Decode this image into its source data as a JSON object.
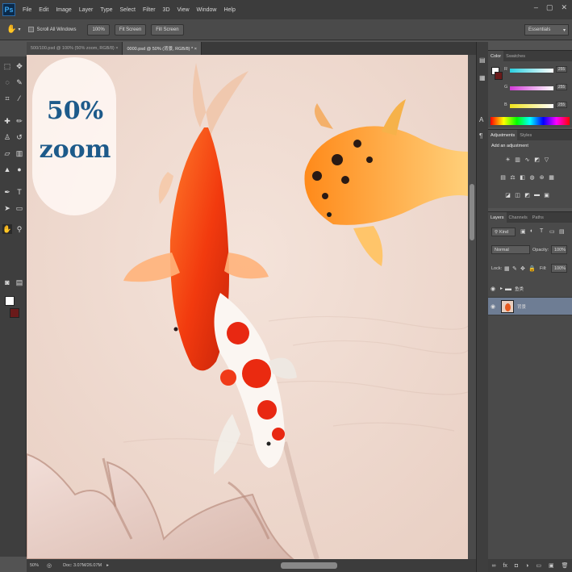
{
  "app": {
    "logo": "Ps"
  },
  "menu": [
    "File",
    "Edit",
    "Image",
    "Layer",
    "Type",
    "Select",
    "Filter",
    "3D",
    "View",
    "Window",
    "Help"
  ],
  "window_controls": [
    "–",
    "▢",
    "✕"
  ],
  "options_bar": {
    "scroll_all_windows": "Scroll All Windows",
    "btn_100": "100%",
    "btn_fit": "Fit Screen",
    "btn_fill": "Fill Screen",
    "workspace": "Essentials"
  },
  "doc_tabs": [
    {
      "label": "500/100.psd @ 100% (50% zoom, RGB/8) ×",
      "active": false
    },
    {
      "label": "0000.psd @ 50% (背景, RGB/8) * ×",
      "active": true
    }
  ],
  "canvas": {
    "zoom_line1": "50%",
    "zoom_line2": "zoom",
    "background_color": "#efd9cf"
  },
  "status_bar": {
    "zoom": "50%",
    "doc": "Doc: 3.07M/26.07M"
  },
  "color_panel": {
    "tabs": [
      "Color",
      "Swatches"
    ],
    "channels": [
      {
        "label": "R",
        "value": "255",
        "color": "#33d6e6"
      },
      {
        "label": "G",
        "value": "255",
        "color": "#d84adb"
      },
      {
        "label": "B",
        "value": "255",
        "color": "#f2ea2a"
      }
    ]
  },
  "adjustments_panel": {
    "tabs": [
      "Adjustments",
      "Styles"
    ],
    "title": "Add an adjustment"
  },
  "layers_panel": {
    "tabs": [
      "Layers",
      "Channels",
      "Paths"
    ],
    "kind": "Kind",
    "blend_mode": "Normal",
    "opacity_label": "Opacity:",
    "opacity": "100%",
    "lock_label": "Lock:",
    "fill_label": "Fill:",
    "fill": "100%",
    "layers": [
      {
        "name": "鱼类",
        "type": "group",
        "selected": false
      },
      {
        "name": "背景",
        "type": "layer",
        "selected": true
      }
    ],
    "footer_icons": [
      "∞",
      "fx",
      "◘",
      "◑",
      "▭",
      "▣",
      "🗑"
    ]
  }
}
